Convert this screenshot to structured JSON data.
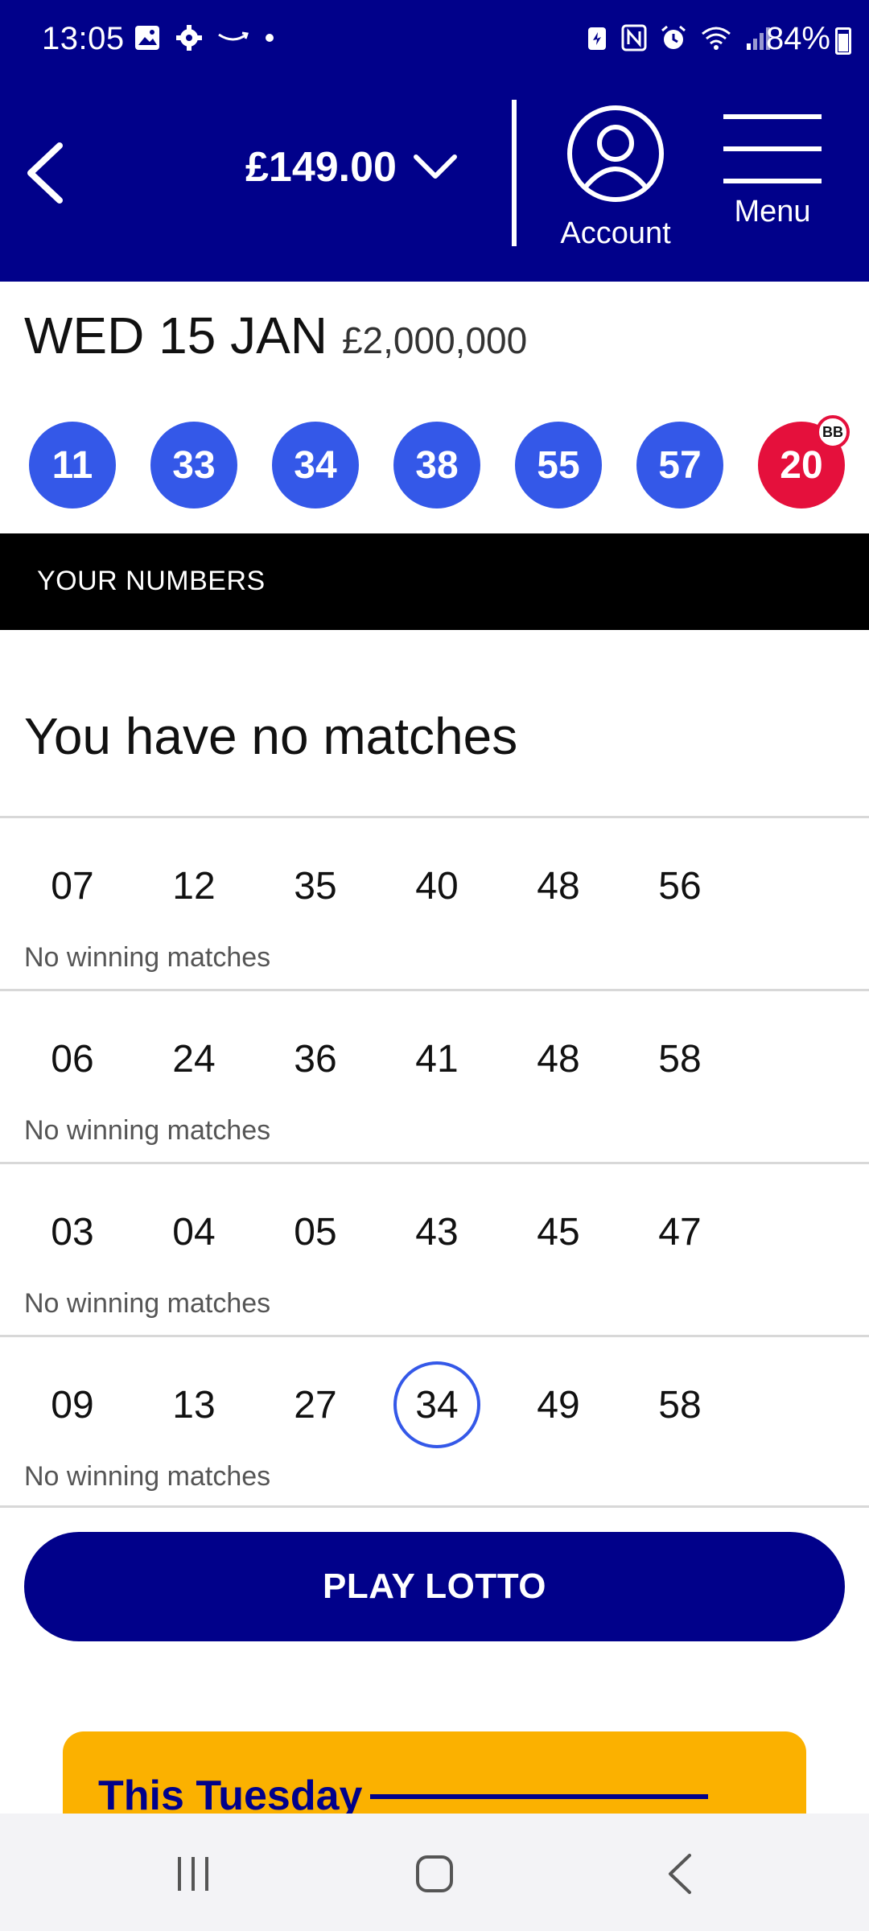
{
  "status_bar": {
    "time": "13:05",
    "battery": "84%"
  },
  "header": {
    "balance": "£149.00",
    "account_label": "Account",
    "menu_label": "Menu"
  },
  "draw": {
    "date": "WED 15 JAN",
    "jackpot": "£2,000,000",
    "balls": [
      "11",
      "33",
      "34",
      "38",
      "55",
      "57"
    ],
    "bonus_ball": "20",
    "bonus_tag": "BB"
  },
  "your_numbers_label": "YOUR NUMBERS",
  "summary": "You have no matches",
  "lines": [
    {
      "numbers": [
        "07",
        "12",
        "35",
        "40",
        "48",
        "56"
      ],
      "status": "No winning matches"
    },
    {
      "numbers": [
        "06",
        "24",
        "36",
        "41",
        "48",
        "58"
      ],
      "status": "No winning matches"
    },
    {
      "numbers": [
        "03",
        "04",
        "05",
        "43",
        "45",
        "47"
      ],
      "status": "No winning matches"
    },
    {
      "numbers": [
        "09",
        "13",
        "27",
        "34",
        "49",
        "58"
      ],
      "status": "No winning matches",
      "matched": [
        "34"
      ]
    }
  ],
  "play_button": "PLAY LOTTO",
  "promo": {
    "title": "This Tuesday"
  },
  "colors": {
    "brand_navy": "#01018a",
    "ball_blue": "#3458e8",
    "bonus_red": "#e5103c",
    "promo_yellow": "#fbb100"
  }
}
